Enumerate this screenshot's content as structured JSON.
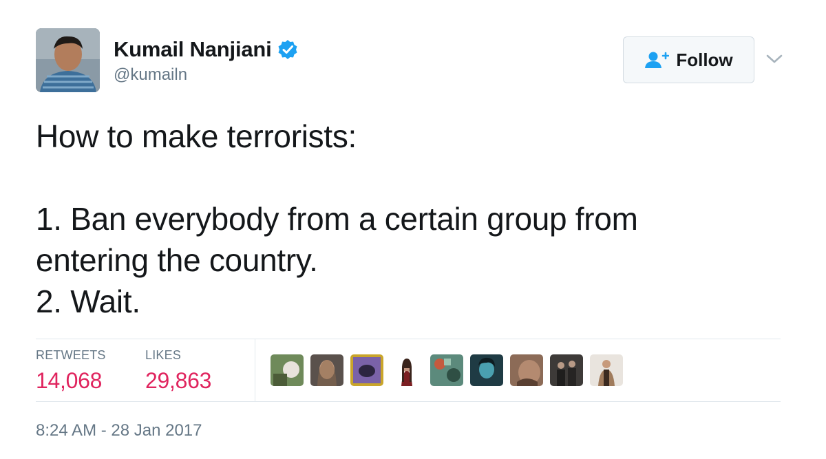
{
  "user": {
    "display_name": "Kumail Nanjiani",
    "handle": "@kumailn",
    "avatar_icon": "profile-photo",
    "verified_icon": "verified-badge-icon",
    "verified_color": "#1da1f2"
  },
  "follow_button": {
    "label": "Follow",
    "icon": "add-user-icon",
    "icon_color": "#1da1f2"
  },
  "menu_caret_icon": "chevron-down-icon",
  "tweet": {
    "lines": [
      "How to make terrorists:",
      "",
      "1. Ban everybody from a certain group from",
      "entering the country.",
      "2. Wait."
    ]
  },
  "stats": {
    "retweets_label": "RETWEETS",
    "retweets_value": "14,068",
    "likes_label": "LIKES",
    "likes_value": "29,863",
    "value_color": "#e0245e"
  },
  "likers_count_shown": 9,
  "timestamp": "8:24 AM - 28 Jan 2017"
}
